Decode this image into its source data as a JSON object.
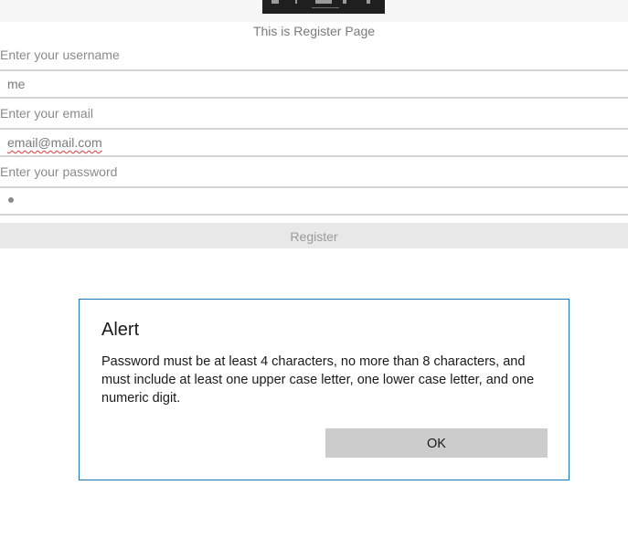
{
  "app": {
    "page_heading": "This is Register Page"
  },
  "form": {
    "username_label": "Enter your username",
    "username_value": "me",
    "email_label": "Enter your email",
    "email_value": "email@mail.com",
    "password_label": "Enter your password",
    "password_masked_length": 1,
    "register_label": "Register"
  },
  "alert": {
    "title": "Alert",
    "message": "Password must be at least 4 characters, no more than 8 characters, and must include at least one upper case letter, one lower case letter, and one numeric digit.",
    "ok_label": "OK"
  },
  "colors": {
    "dialog_border": "#1a78b4",
    "ok_button_bg": "#cccccc",
    "register_bg": "#e8e8e8",
    "toolbar_bg": "#1f1f1f"
  }
}
